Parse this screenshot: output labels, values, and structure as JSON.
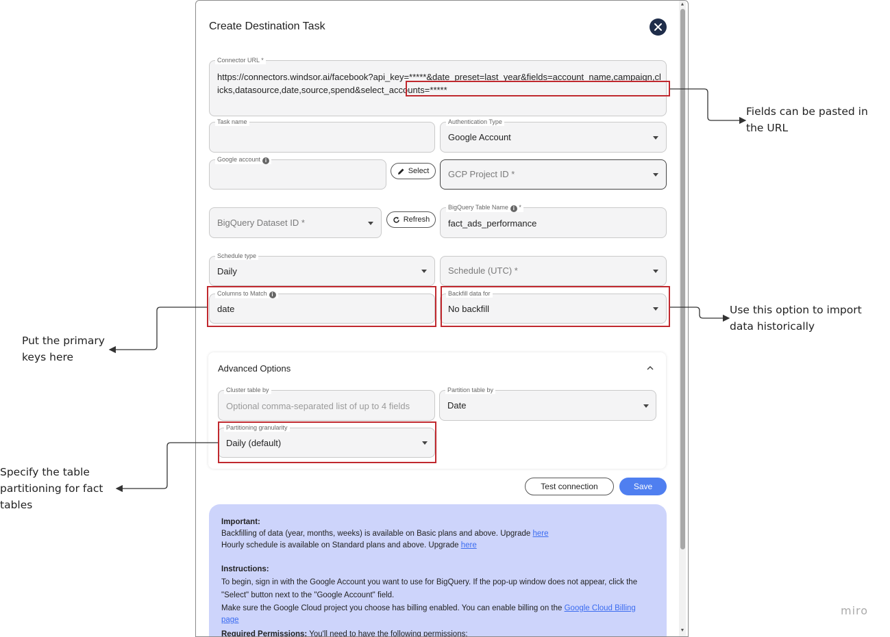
{
  "modal": {
    "title": "Create Destination Task",
    "connector_url": {
      "label": "Connector URL *",
      "value": "https://connectors.windsor.ai/facebook?api_key=*****&date_preset=last_year&fields=account_name,campaign,clicks,datasource,date,source,spend&select_accounts=*****"
    },
    "task_name": {
      "label": "Task name",
      "value": ""
    },
    "auth_type": {
      "label": "Authentication Type",
      "value": "Google Account"
    },
    "google_account": {
      "label": "Google account",
      "value": ""
    },
    "select_button": "Select",
    "gcp_project": {
      "placeholder": "GCP Project ID *"
    },
    "dataset": {
      "placeholder": "BigQuery Dataset ID *"
    },
    "refresh_button": "Refresh",
    "table_name": {
      "label": "BigQuery Table Name",
      "required": "*",
      "value": "fact_ads_performance"
    },
    "schedule_type": {
      "label": "Schedule type",
      "value": "Daily"
    },
    "schedule_utc": {
      "placeholder": "Schedule (UTC) *"
    },
    "columns_to_match": {
      "label": "Columns to Match",
      "value": "date"
    },
    "backfill": {
      "label": "Backfill data for",
      "value": "No backfill"
    },
    "advanced": {
      "title": "Advanced Options",
      "cluster": {
        "label": "Cluster table by",
        "placeholder": "Optional comma-separated list of up to 4 fields"
      },
      "partition": {
        "label": "Partition table by",
        "value": "Date"
      },
      "granularity": {
        "label": "Partitioning granularity",
        "value": "Daily (default)"
      }
    },
    "test_button": "Test connection",
    "save_button": "Save",
    "info": {
      "important_heading": "Important:",
      "line1": "Backfilling of data (year, months, weeks) is available on Basic plans and above. Upgrade",
      "line1_link": "here",
      "line2": "Hourly schedule is available on Standard plans and above. Upgrade",
      "line2_link": "here",
      "instructions_heading": "Instructions:",
      "instr1": "To begin, sign in with the Google Account you want to use for BigQuery. If the pop-up window does not appear, click the",
      "instr2": "\"Select\" button next to the \"Google Account\" field.",
      "instr3": "Make sure the Google Cloud project you choose has billing enabled. You can enable billing on the",
      "instr3_link": "Google Cloud Billing page",
      "perm_heading": "Required Permissions:",
      "perm_text": "You'll need to have the following permissions:"
    }
  },
  "annotations": {
    "url": [
      "Fields can be pasted in",
      "the URL"
    ],
    "backfill": [
      "Use this option to import",
      "data historically"
    ],
    "keys": [
      "Put the primary",
      "keys here"
    ],
    "partition": [
      "Specify the table",
      "partitioning for fact",
      "tables"
    ]
  },
  "watermark": "miro",
  "colors": {
    "highlight": "#c0282e",
    "save": "#4f7ff0",
    "info_panel": "#cdd4fb",
    "close": "#1f2d4a"
  }
}
